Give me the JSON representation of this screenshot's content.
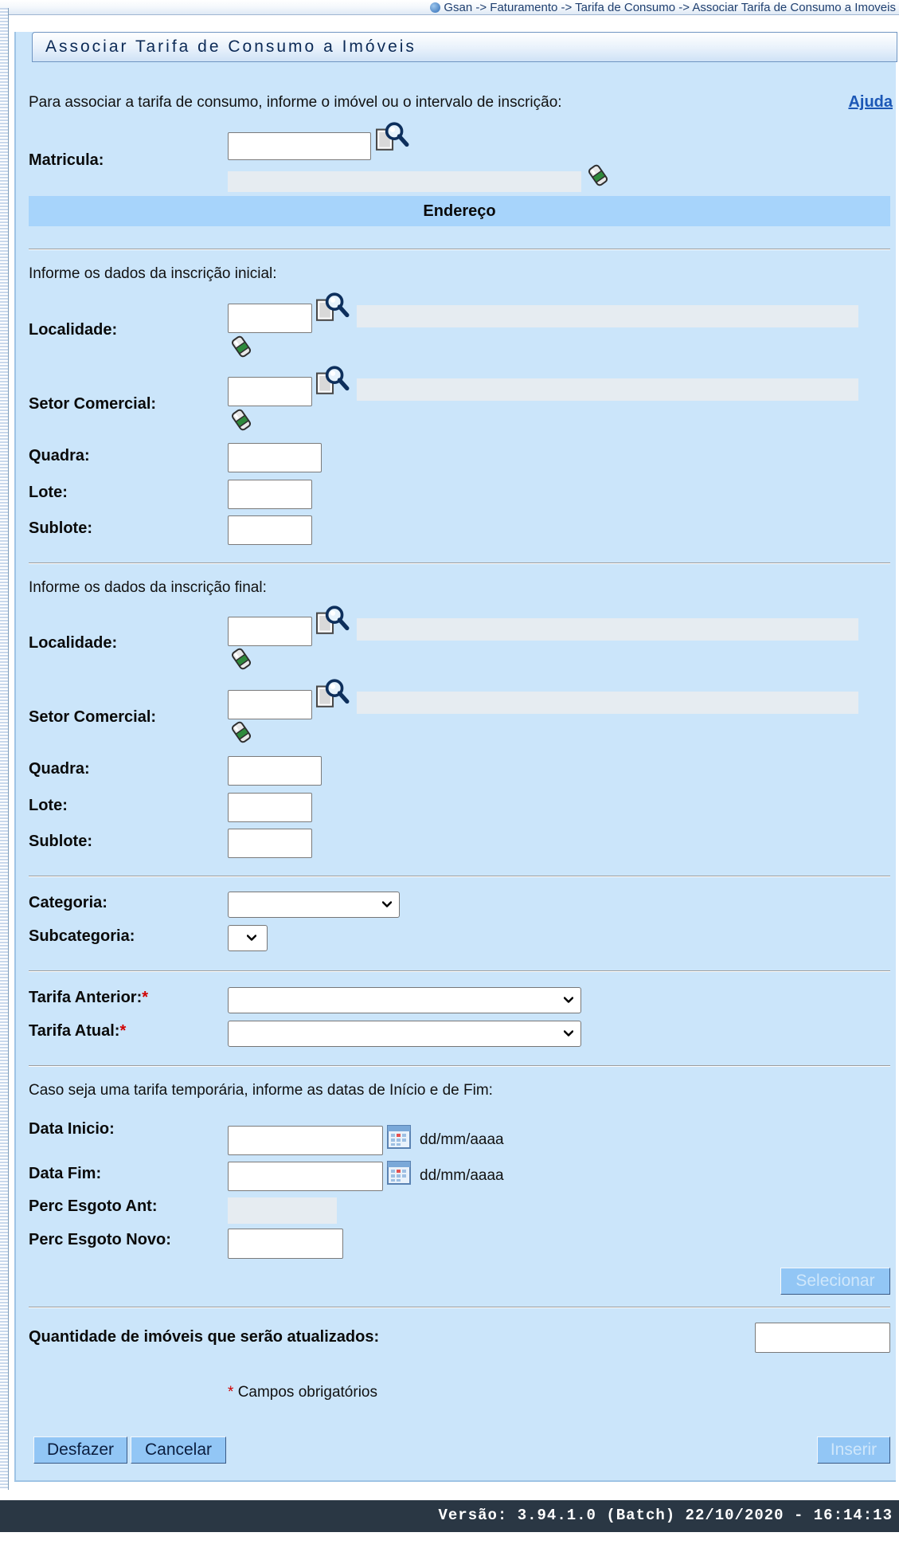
{
  "breadcrumb": "Gsan -> Faturamento -> Tarifa de Consumo -> Associar Tarifa de Consumo a Imoveis",
  "title": "Associar Tarifa de Consumo a Imóveis",
  "intro": "Para associar a tarifa de consumo, informe o imóvel ou o intervalo de inscrição:",
  "help_link": "Ajuda",
  "matricula_label": "Matricula:",
  "endereco_header": "Endereço",
  "inicial": {
    "heading": "Informe os dados da inscrição inicial:",
    "localidade": "Localidade:",
    "setor": "Setor Comercial:",
    "quadra": "Quadra:",
    "lote": "Lote:",
    "sublote": "Sublote:"
  },
  "final": {
    "heading": "Informe os dados da inscrição final:",
    "localidade": "Localidade:",
    "setor": "Setor Comercial:",
    "quadra": "Quadra:",
    "lote": "Lote:",
    "sublote": "Sublote:"
  },
  "categoria_label": "Categoria:",
  "subcategoria_label": "Subcategoria:",
  "tarifa_anterior_label": "Tarifa Anterior:",
  "tarifa_atual_label": "Tarifa Atual:",
  "required_mark": "*",
  "temporaria_text": "Caso seja uma tarifa temporária, informe as datas de Início e de Fim:",
  "data_inicio_label": "Data Inicio:",
  "data_fim_label": "Data Fim:",
  "date_format": "dd/mm/aaaa",
  "perc_ant_label": "Perc Esgoto Ant:",
  "perc_novo_label": "Perc Esgoto Novo:",
  "selecionar_button": "Selecionar",
  "quantidade_label": "Quantidade de imóveis que serão atualizados:",
  "obrigatorios_text": "Campos obrigatórios",
  "desfazer_button": "Desfazer",
  "cancelar_button": "Cancelar",
  "inserir_button": "Inserir",
  "version": "Versão: 3.94.1.0 (Batch) 22/10/2020 - 16:14:13",
  "colors": {
    "panel_bg": "#cbe5fa",
    "header_bg": "#a7d4fb",
    "button_bg": "#92c6f5",
    "link": "#1b57b6",
    "required": "#d00000",
    "footer_bg": "#2a3744"
  },
  "icons": [
    "search-icon",
    "eraser-icon",
    "calendar-icon",
    "chevron-down-icon",
    "help-icon"
  ]
}
